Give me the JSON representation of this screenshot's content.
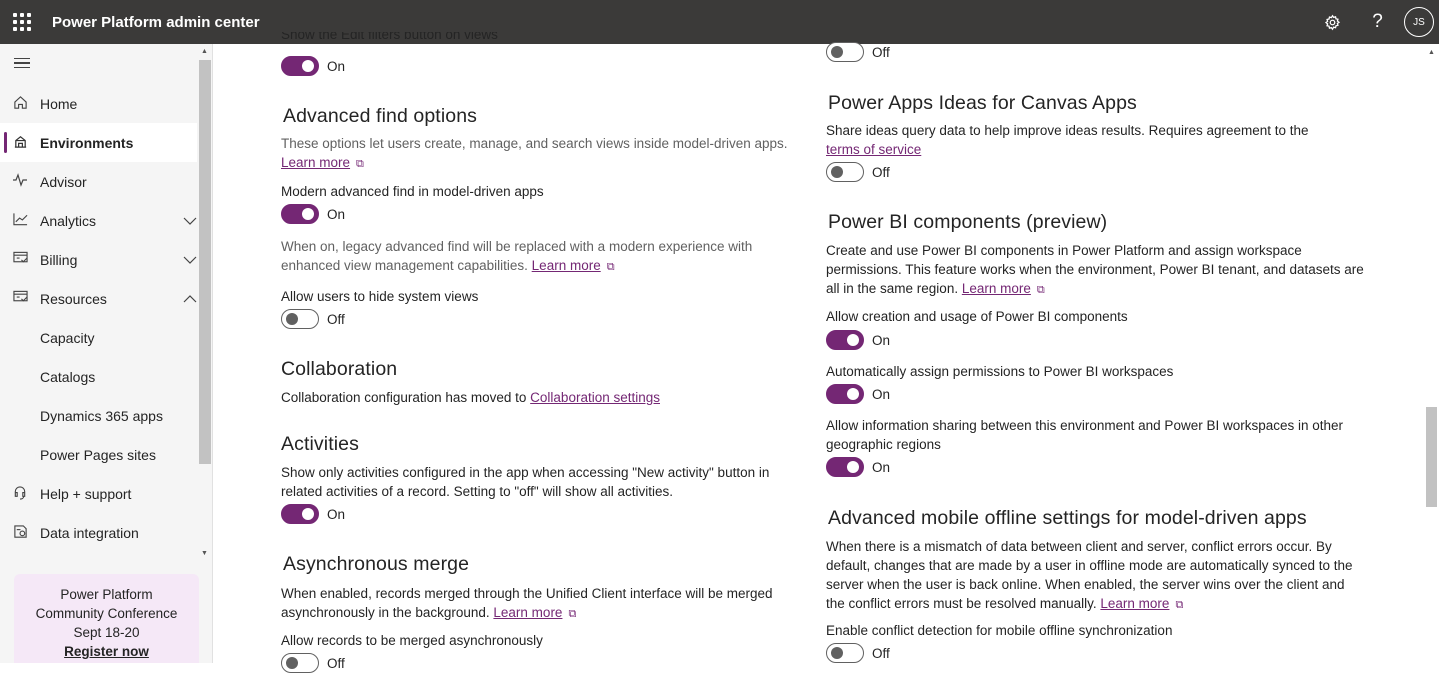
{
  "header": {
    "app_title": "Power Platform admin center",
    "avatar_initials": "JS",
    "icons": [
      "app-launcher-icon",
      "settings-gear-icon",
      "help-question-icon"
    ]
  },
  "sidebar": {
    "items": [
      {
        "label": "Home",
        "icon": "home-icon"
      },
      {
        "label": "Environments",
        "icon": "environments-icon",
        "active": true
      },
      {
        "label": "Advisor",
        "icon": "advisor-pulse-icon"
      },
      {
        "label": "Analytics",
        "icon": "analytics-chart-icon",
        "expand": "down"
      },
      {
        "label": "Billing",
        "icon": "billing-icon",
        "expand": "down"
      },
      {
        "label": "Resources",
        "icon": "resources-icon",
        "expand": "up"
      },
      {
        "label": "Capacity"
      },
      {
        "label": "Catalogs"
      },
      {
        "label": "Dynamics 365 apps"
      },
      {
        "label": "Power Pages sites"
      },
      {
        "label": "Help + support",
        "icon": "help-support-icon"
      },
      {
        "label": "Data integration",
        "icon": "data-integration-icon"
      }
    ],
    "promo": {
      "line1": "Power Platform",
      "line2": "Community Conference",
      "line3": "Sept 18-20",
      "link": "Register now"
    }
  },
  "left": {
    "edit_filters_label": "Show the Edit filters button on views",
    "edit_filters_state": "On",
    "advanced_find": {
      "title": "Advanced find options",
      "desc": "These options let users create, manage, and search views inside model-driven apps.",
      "learn_more": "Learn more",
      "modern_label": "Modern advanced find in model-driven apps",
      "modern_state": "On",
      "modern_desc": "When on, legacy advanced find will be replaced with a modern experience with enhanced view management capabilities.",
      "modern_learn_more": "Learn more",
      "hide_label": "Allow users to hide system views",
      "hide_state": "Off"
    },
    "collaboration": {
      "title": "Collaboration",
      "desc": "Collaboration configuration has moved to",
      "link": "Collaboration settings"
    },
    "activities": {
      "title": "Activities",
      "desc": "Show only activities configured in the app when accessing \"New activity\" button in related activities of a record. Setting to \"off\" will show all activities.",
      "state": "On"
    },
    "async_merge": {
      "title": "Asynchronous merge",
      "desc": "When enabled, records merged through the Unified Client interface will be merged asynchronously in the background.",
      "learn_more": "Learn more",
      "label": "Allow records to be merged asynchronously",
      "state": "Off"
    }
  },
  "right": {
    "top_state": "Off",
    "ideas": {
      "title": "Power Apps Ideas for Canvas Apps",
      "desc": "Share ideas query data to help improve ideas results. Requires agreement to the",
      "link": "terms of service",
      "state": "Off"
    },
    "powerbi": {
      "title": "Power BI components (preview)",
      "desc": "Create and use Power BI components in Power Platform and assign workspace permissions. This feature works when the environment, Power BI tenant, and datasets are all in the same region.",
      "learn_more": "Learn more",
      "allow_label": "Allow creation and usage of Power BI components",
      "allow_state": "On",
      "assign_label": "Automatically assign permissions to Power BI workspaces",
      "assign_state": "On",
      "share_label": "Allow information sharing between this environment and Power BI workspaces in other geographic regions",
      "share_state": "On"
    },
    "mobile_offline": {
      "title": "Advanced mobile offline settings for model-driven apps",
      "desc": "When there is a mismatch of data between client and server, conflict errors occur. By default, changes that are made by a user in offline mode are automatically synced to the server when the user is back online. When enabled, the server wins over the client and the conflict errors must be resolved manually.",
      "learn_more": "Learn more",
      "conflict_label": "Enable conflict detection for mobile offline synchronization",
      "conflict_state": "Off"
    }
  },
  "colors": {
    "accent": "#742774",
    "header_bg": "#3b3a39",
    "promo_bg": "#f5e8f7"
  }
}
